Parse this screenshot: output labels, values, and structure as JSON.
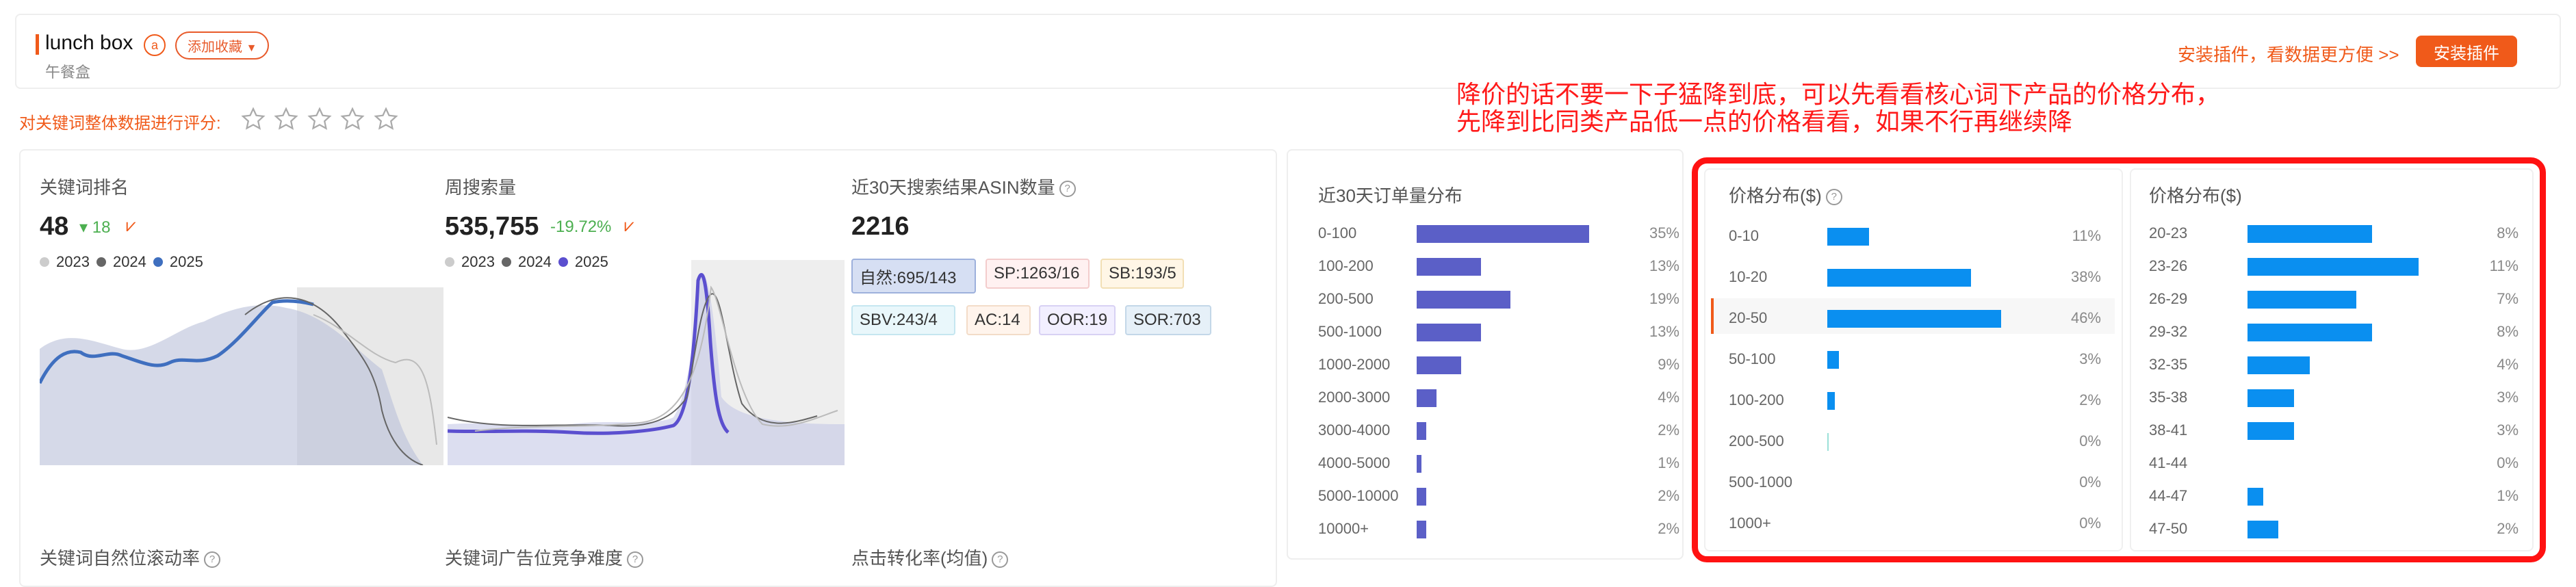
{
  "header": {
    "title": "lunch box",
    "badge": "a",
    "subtitle": "午餐盒",
    "fav_label": "添加收藏",
    "install_hint": "安装插件，看数据更方便 >>",
    "install_button": "安装插件"
  },
  "rating": {
    "label": "对关键词整体数据进行评分:",
    "stars": 5,
    "value": 0
  },
  "annotation": {
    "line1": "降价的话不要一下子猛降到底，可以先看看核心词下产品的价格分布，",
    "line2": "先降到比同类产品低一点的价格看看，如果不行再继续降"
  },
  "metrics": {
    "rank": {
      "label": "关键词排名",
      "value": "48",
      "delta": "18",
      "legend": [
        "2023",
        "2024",
        "2025"
      ]
    },
    "search": {
      "label": "周搜索量",
      "value": "535,755",
      "delta": "-19.72%",
      "legend": [
        "2023",
        "2024",
        "2025"
      ]
    },
    "asin": {
      "label": "近30天搜索结果ASIN数量",
      "value": "2216",
      "tags": [
        {
          "name": "自然:",
          "val": "695/143"
        },
        {
          "name": "SP:",
          "val": "1263/16"
        },
        {
          "name": "SB:",
          "val": "193/5"
        },
        {
          "name": "SBV:",
          "val": "243/4"
        },
        {
          "name": "AC:",
          "val": "14"
        },
        {
          "name": "OOR:",
          "val": "19"
        },
        {
          "name": "SOR:",
          "val": "703"
        }
      ]
    },
    "bottom_labels": [
      "关键词自然位滚动率",
      "关键词广告位竞争难度",
      "点击转化率(均值)"
    ]
  },
  "colors": {
    "accent": "#f05a1a",
    "bar_purple": "#5b5fc7",
    "bar_blue": "#0a8ff0",
    "red": "#ff1a1a"
  },
  "chart_data": [
    {
      "type": "bar",
      "title": "近30天订单量分布",
      "categories": [
        "0-100",
        "100-200",
        "200-500",
        "500-1000",
        "1000-2000",
        "2000-3000",
        "3000-4000",
        "4000-5000",
        "5000-10000",
        "10000+"
      ],
      "values": [
        35,
        13,
        19,
        13,
        9,
        4,
        2,
        1,
        2,
        2
      ],
      "labels": [
        "35%",
        "13%",
        "19%",
        "13%",
        "9%",
        "4%",
        "2%",
        "1%",
        "2%",
        "2%"
      ]
    },
    {
      "type": "bar",
      "title": "价格分布($)",
      "categories": [
        "0-10",
        "10-20",
        "20-50",
        "50-100",
        "100-200",
        "200-500",
        "500-1000",
        "1000+"
      ],
      "values": [
        11,
        38,
        46,
        3,
        2,
        0,
        0,
        0
      ],
      "labels": [
        "11%",
        "38%",
        "46%",
        "3%",
        "2%",
        "0%",
        "0%",
        "0%"
      ]
    },
    {
      "type": "bar",
      "title": "价格分布($)",
      "categories": [
        "20-23",
        "23-26",
        "26-29",
        "29-32",
        "32-35",
        "35-38",
        "38-41",
        "41-44",
        "44-47",
        "47-50"
      ],
      "values": [
        8,
        11,
        7,
        8,
        4,
        3,
        3,
        0,
        1,
        2
      ],
      "labels": [
        "8%",
        "11%",
        "7%",
        "8%",
        "4%",
        "3%",
        "3%",
        "0%",
        "1%",
        "2%"
      ]
    }
  ]
}
